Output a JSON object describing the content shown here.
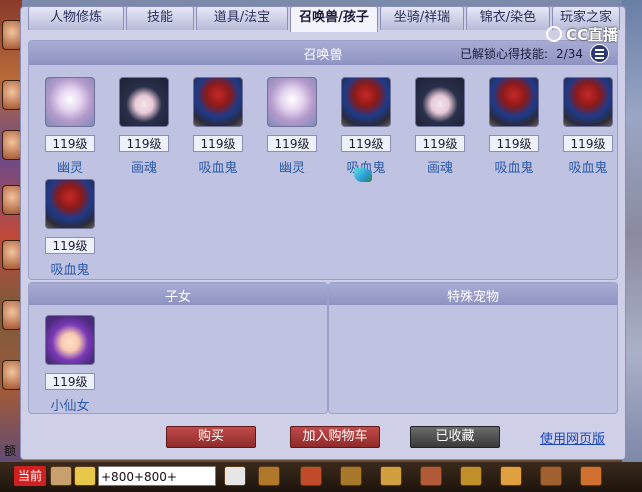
{
  "tabs": [
    {
      "label": "人物修炼"
    },
    {
      "label": "技能"
    },
    {
      "label": "道具/法宝"
    },
    {
      "label": "召唤兽/孩子",
      "active": true
    },
    {
      "label": "坐骑/祥瑞"
    },
    {
      "label": "锦衣/染色"
    },
    {
      "label": "玩家之家"
    }
  ],
  "summons": {
    "title": "召唤兽",
    "unlock_label": "已解锁心得技能:",
    "unlock_value": "2/34",
    "pets": [
      {
        "name": "幽灵",
        "level": "119级",
        "icon": "ghost"
      },
      {
        "name": "画魂",
        "level": "119级",
        "icon": "painter"
      },
      {
        "name": "吸血鬼",
        "level": "119级",
        "icon": "vamp"
      },
      {
        "name": "幽灵",
        "level": "119级",
        "icon": "ghost"
      },
      {
        "name": "吸血鬼",
        "level": "119级",
        "icon": "vamp"
      },
      {
        "name": "画魂",
        "level": "119级",
        "icon": "painter"
      },
      {
        "name": "吸血鬼",
        "level": "119级",
        "icon": "vamp"
      },
      {
        "name": "吸血鬼",
        "level": "119级",
        "icon": "vamp"
      },
      {
        "name": "吸血鬼",
        "level": "119级",
        "icon": "vamp"
      }
    ]
  },
  "children": {
    "title": "子女",
    "items": [
      {
        "name": "小仙女",
        "level": "119级",
        "icon": "fairy"
      }
    ]
  },
  "special": {
    "title": "特殊宠物"
  },
  "actions": {
    "buy": "购买",
    "add_cart": "加入购物车",
    "favorited": "已收藏",
    "web_link": "使用网页版"
  },
  "bottom": {
    "current_channel": "当前",
    "chat_input": "+800+800+",
    "stray_text": "额",
    "watermark": "CC直播"
  },
  "colors": {
    "accent_red": "#c24a4a",
    "link_blue": "#1a45b8",
    "panel": "#bfc2e0"
  }
}
